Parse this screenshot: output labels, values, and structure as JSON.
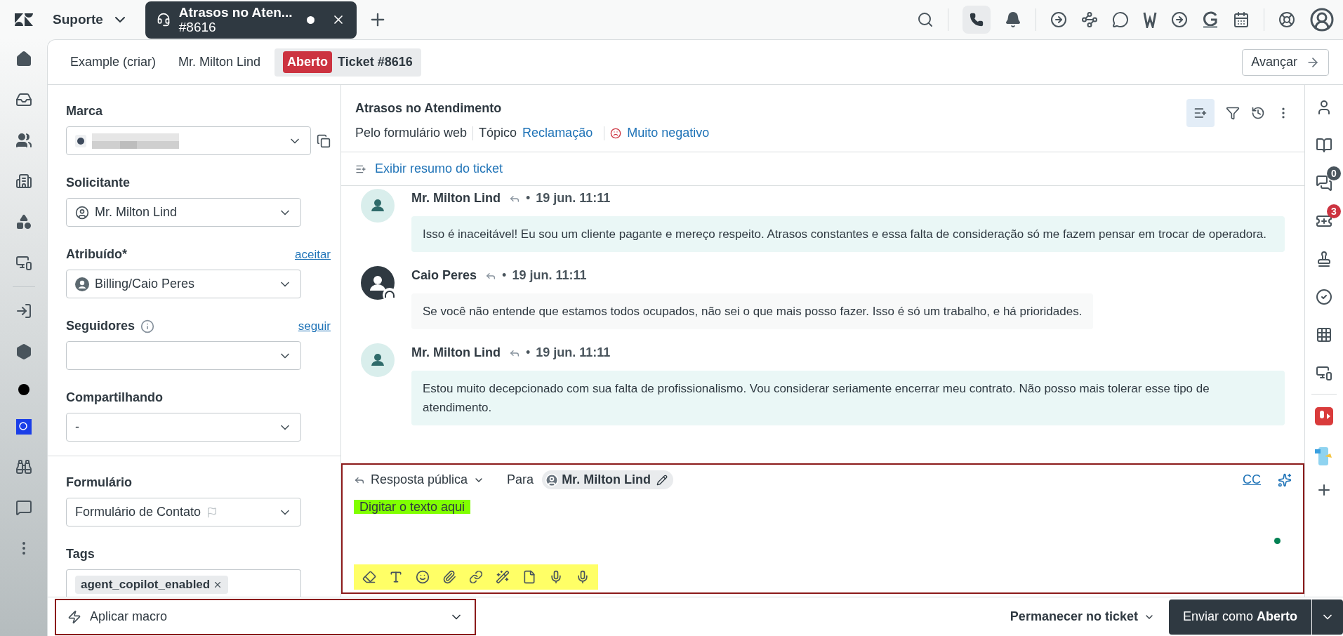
{
  "top_bar": {
    "workspace": "Suporte",
    "tab": {
      "title": "Atrasos no Aten...",
      "number": "#8616",
      "unsaved": true
    }
  },
  "subtabs": [
    {
      "label": "Example (criar)",
      "selected": false
    },
    {
      "label": "Mr. Milton Lind",
      "selected": false
    },
    {
      "badge": "Aberto",
      "label": "Ticket #8616",
      "selected": true
    }
  ],
  "next_button": "Avançar",
  "sections": [
    [
      {
        "kind": "brand",
        "label": "Marca"
      },
      {
        "kind": "person",
        "label": "Solicitante",
        "value": "Mr. Milton Lind",
        "avatar": {
          "kind": "outline"
        }
      },
      {
        "kind": "person",
        "label": "Atribuído*",
        "value": "Billing/Caio Peres",
        "avatar": {
          "kind": "filled"
        },
        "link": "aceitar"
      },
      {
        "kind": "empty",
        "label": "Seguidores",
        "link": "seguir",
        "info": true
      },
      {
        "kind": "plain",
        "label": "Compartilhando",
        "value": "-"
      }
    ],
    [
      {
        "kind": "plain",
        "label": "Formulário",
        "value": "Formulário de Contato",
        "flag": true
      },
      {
        "kind": "tags",
        "label": "Tags",
        "tags": [
          "agent_copilot_enabled"
        ]
      }
    ]
  ],
  "ticket": {
    "title": "Atrasos no Atendimento",
    "channel": "Pelo formulário web",
    "topic_label": "Tópico",
    "topic": "Reclamação",
    "sentiment": "Muito negativo",
    "summary_link": "Exibir resumo do ticket"
  },
  "messages": [
    {
      "kind": "customer",
      "author": "Mr. Milton Lind",
      "separator": "•",
      "time": "19 jun. 11:11",
      "body": "Isso é inaceitável! Eu sou um cliente pagante e mereço respeito. Atrasos constantes e essa falta de consideração só me fazem pensar em trocar de operadora."
    },
    {
      "kind": "agent",
      "author": "Caio Peres",
      "separator": "•",
      "time": "19 jun. 11:11",
      "body": "Se você não entende que estamos todos ocupados, não sei o que mais posso fazer. Isso é só um trabalho, e há prioridades."
    },
    {
      "kind": "customer",
      "author": "Mr. Milton Lind",
      "separator": "•",
      "time": "19 jun. 11:11",
      "body": "Estou muito decepcionado com sua falta de profissionalismo. Vou considerar seriamente encerrar meu contrato. Não posso mais tolerar esse tipo de atendimento."
    }
  ],
  "composer": {
    "reply_type": "Resposta pública",
    "to_label": "Para",
    "recipient": "Mr. Milton Lind",
    "cc": "CC",
    "placeholder": "Digitar o texto aqui",
    "online": true
  },
  "macro": {
    "placeholder": "Aplicar macro"
  },
  "stay": "Permanecer no ticket",
  "submit": "Enviar como **Aberto**",
  "right_sidebar": [
    {
      "kind": "user"
    },
    {
      "kind": "book"
    },
    {
      "kind": "chat",
      "count": "0",
      "color": "#49545c"
    },
    {
      "kind": "ticket",
      "count": "3",
      "color": "#cc3340"
    },
    {
      "kind": "stamp"
    },
    {
      "kind": "check"
    },
    {
      "kind": "grid"
    },
    {
      "kind": "device"
    }
  ]
}
